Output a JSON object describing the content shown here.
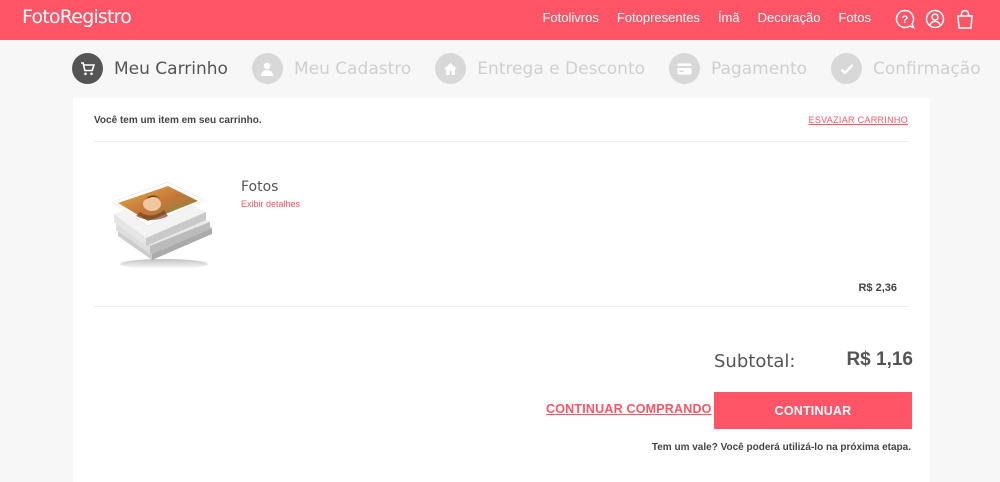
{
  "header": {
    "logo": "FotoRegistro",
    "nav": [
      "Fotolivros",
      "Fotopresentes",
      "Ímã",
      "Decoração",
      "Fotos"
    ],
    "icons": [
      "help-icon",
      "user-icon",
      "bag-icon"
    ]
  },
  "steps": [
    {
      "label": "Meu Carrinho",
      "icon": "cart-icon",
      "active": true
    },
    {
      "label": "Meu Cadastro",
      "icon": "user-icon",
      "active": false
    },
    {
      "label": "Entrega e Desconto",
      "icon": "home-icon",
      "active": false
    },
    {
      "label": "Pagamento",
      "icon": "card-icon",
      "active": false
    },
    {
      "label": "Confirmação",
      "icon": "check-icon",
      "active": false
    }
  ],
  "cart": {
    "message": "Você tem um item em seu carrinho.",
    "empty_link": "ESVAZIAR CARRINHO",
    "item": {
      "name": "Fotos",
      "details_link": "Exibir detalhes",
      "price": "R$ 2,36"
    },
    "subtotal_label": "Subtotal:",
    "subtotal_value": "R$ 1,16",
    "continue_shopping": "CONTINUAR COMPRANDO",
    "continue_button": "CONTINUAR",
    "voucher_note": "Tem um vale? Você poderá utilizá-lo na próxima etapa."
  },
  "colors": {
    "brand": "#ff5566",
    "step_active": "#555555",
    "step_inactive": "#d8d8d8"
  }
}
